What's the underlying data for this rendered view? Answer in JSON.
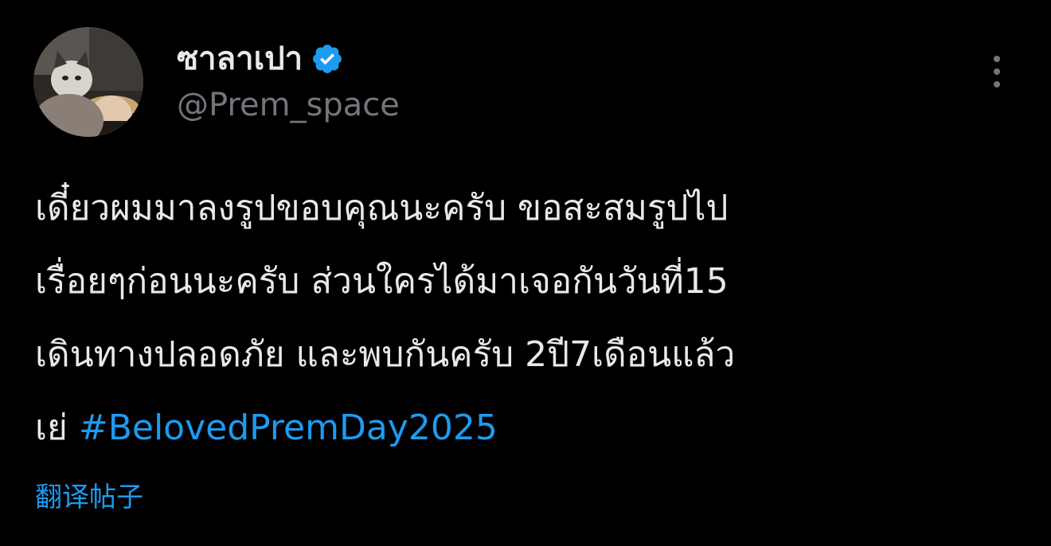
{
  "author": {
    "display_name": "ซาลาเปา",
    "handle": "@Prem_space",
    "verified": true
  },
  "icons": {
    "verified": "verified-badge-icon",
    "more": "more-vertical-icon"
  },
  "tweet": {
    "lines": [
      "เดี๋ยวผมมาลงรูปขอบคุณนะครับ ขอสะสมรูปไป",
      "เรื่อยๆก่อนนะครับ ส่วนใครได้มาเจอกันวันที่15",
      "เดินทางปลอดภัย และพบกันครับ 2ปี7เดือนแล้ว",
      "เย่"
    ],
    "hashtag": "#BelovedPremDay2025"
  },
  "translate_label": "翻译帖子",
  "colors": {
    "background": "#000000",
    "text": "#e7e9ea",
    "secondary": "#71767b",
    "accent": "#1d9bf0"
  }
}
